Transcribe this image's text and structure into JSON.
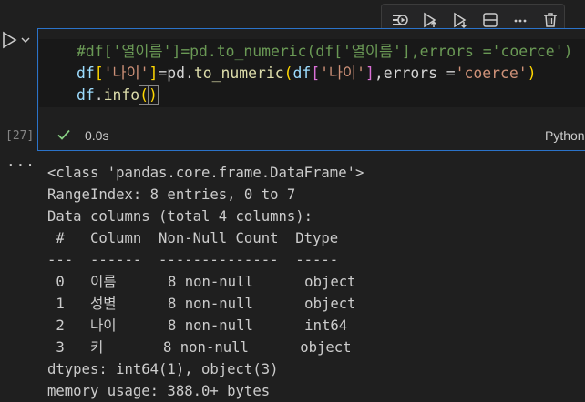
{
  "toolbar": {
    "buttons": [
      "run-by-line-icon",
      "execute-above-icon",
      "execute-below-icon",
      "split-cell-icon",
      "more-icon",
      "delete-icon"
    ]
  },
  "cell": {
    "code_line1": "#df['열이름']=pd.to_numeric(df['열이름'],errors ='coerce')",
    "code_line2_parts": [
      "df",
      "[",
      "'나이'",
      "]",
      "=pd.",
      "to_numeric",
      "(",
      "df",
      "[",
      "'나이'",
      "]",
      ",errors =",
      "'coerce'",
      ")"
    ],
    "code_line3_parts": [
      "df",
      ".",
      "info",
      "(",
      ")"
    ],
    "execution_count": "[27]",
    "status_time": "0.0s",
    "language": "Python"
  },
  "output": {
    "lines": [
      "<class 'pandas.core.frame.DataFrame'>",
      "RangeIndex: 8 entries, 0 to 7",
      "Data columns (total 4 columns):",
      " #   Column  Non-Null Count  Dtype ",
      "---  ------  --------------  ----- ",
      " 0   이름      8 non-null      object",
      " 1   성별      8 non-null      object",
      " 2   나이      8 non-null      int64 ",
      " 3   키       8 non-null      object",
      "dtypes: int64(1), object(3)",
      "memory usage: 388.0+ bytes"
    ]
  },
  "colors": {
    "background": "#1f1f1f",
    "cell_border": "#2b73c9",
    "success_check": "#89d185"
  }
}
